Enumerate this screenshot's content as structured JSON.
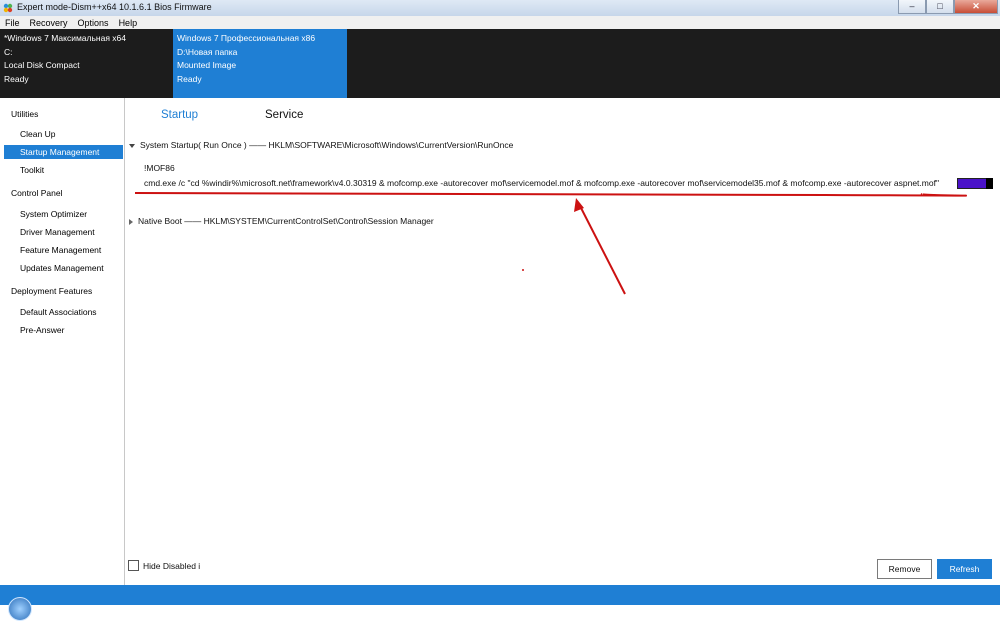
{
  "window": {
    "title": "Expert mode-Dism++x64 10.1.6.1 Bios Firmware",
    "buttons": {
      "minimize": "–",
      "maximize": "□",
      "close": "✕"
    }
  },
  "menu": [
    "File",
    "Recovery",
    "Options",
    "Help"
  ],
  "sessions": [
    {
      "name": "*Windows 7 Максимальная x64",
      "drive": "C:",
      "type": "Local Disk Compact",
      "status": "Ready",
      "selected": false
    },
    {
      "name": "Windows 7 Профессиональная x86",
      "drive": "D:\\Новая папка",
      "type": "Mounted Image",
      "status": "Ready",
      "selected": true
    }
  ],
  "sidebar": {
    "groups": [
      {
        "label": "Utilities",
        "items": [
          "Clean Up",
          "Startup Management",
          "Toolkit"
        ]
      },
      {
        "label": "Control Panel",
        "items": [
          "System Optimizer",
          "Driver Management",
          "Feature Management",
          "Updates Management"
        ]
      },
      {
        "label": "Deployment Features",
        "items": [
          "Default Associations",
          "Pre-Answer"
        ]
      }
    ],
    "selected": "Startup Management"
  },
  "tabs": {
    "active": "Startup",
    "items": [
      "Startup",
      "Service"
    ]
  },
  "sections": [
    {
      "title": "System Startup( Run Once ) —— HKLM\\SOFTWARE\\Microsoft\\Windows\\CurrentVersion\\RunOnce",
      "expanded": true
    },
    {
      "title": "Native Boot —— HKLM\\SYSTEM\\CurrentControlSet\\Control\\Session Manager",
      "expanded": false
    }
  ],
  "entry": {
    "name": "!MOF86",
    "command": "cmd.exe /c \"cd %windir%\\microsoft.net\\framework\\v4.0.30319 & mofcomp.exe -autorecover mof\\servicemodel.mof & mofcomp.exe -autorecover mof\\servicemodel35.mof & mofcomp.exe -autorecover aspnet.mof\"",
    "enabled": true
  },
  "footer": {
    "hide_disabled_label": "Hide Disabled i",
    "hide_disabled_checked": false,
    "remove_label": "Remove",
    "refresh_label": "Refresh"
  },
  "colors": {
    "accent": "#1f7fd4",
    "toggle_on": "#4a12c9",
    "annotation": "#cc1111"
  }
}
